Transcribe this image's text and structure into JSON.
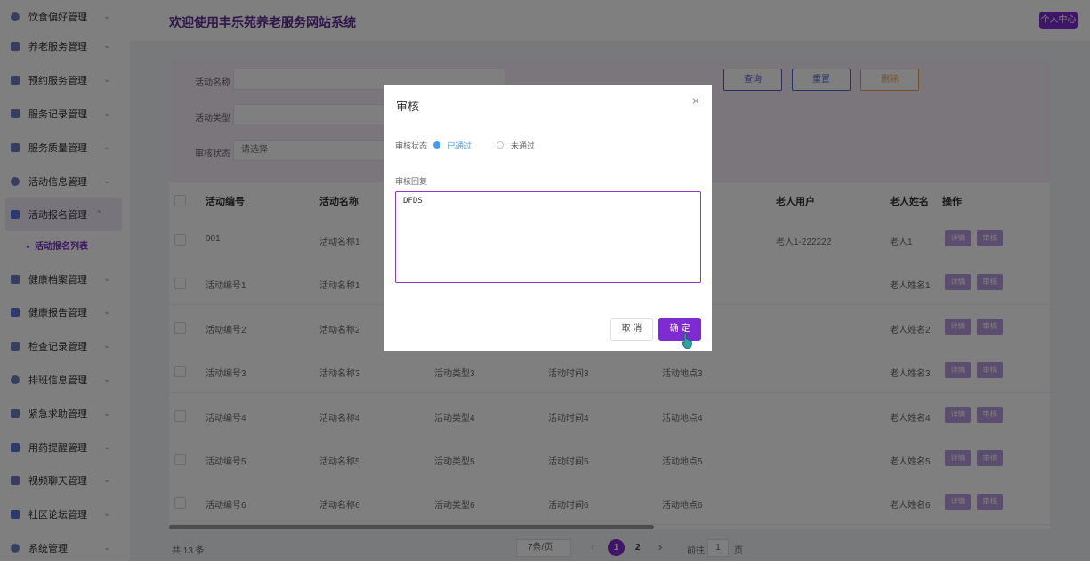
{
  "sidebar": {
    "items": [
      {
        "label": "饮食偏好管理",
        "icon": "drop-icon"
      },
      {
        "label": "养老服务管理",
        "icon": "document-icon"
      },
      {
        "label": "预约服务管理",
        "icon": "calendar-icon"
      },
      {
        "label": "服务记录管理",
        "icon": "edit-icon"
      },
      {
        "label": "服务质量管理",
        "icon": "chart-icon"
      },
      {
        "label": "活动信息管理",
        "icon": "drop-icon"
      },
      {
        "label": "活动报名管理",
        "icon": "list-icon",
        "active": true
      },
      {
        "label": "健康档案管理",
        "icon": "document-icon"
      },
      {
        "label": "健康报告管理",
        "icon": "list-icon"
      },
      {
        "label": "检查记录管理",
        "icon": "calendar-icon"
      },
      {
        "label": "排班信息管理",
        "icon": "drop-icon"
      },
      {
        "label": "紧急求助管理",
        "icon": "edit-icon"
      },
      {
        "label": "用药提醒管理",
        "icon": "list-icon"
      },
      {
        "label": "视频聊天管理",
        "icon": "document-icon"
      },
      {
        "label": "社区论坛管理",
        "icon": "list-icon"
      },
      {
        "label": "系统管理",
        "icon": "drop-icon"
      }
    ],
    "sub_item": "活动报名列表"
  },
  "header": {
    "title": "欢迎使用丰乐苑养老服务网站系统",
    "user_button": "个人中心"
  },
  "search": {
    "name_label": "活动名称",
    "type_label": "活动类型",
    "status_label": "审核状态",
    "status_placeholder": "请选择",
    "query_button": "查询",
    "reset_button": "重置",
    "delete_button": "删除"
  },
  "table": {
    "headers": {
      "id": "活动编号",
      "name": "活动名称",
      "elder_user": "老人用户",
      "elder_name": "老人姓名",
      "ops": "操作"
    },
    "rows": [
      {
        "id": "001",
        "name": "活动名称1",
        "type": "",
        "time": "",
        "place": "",
        "user": "老人1-222222",
        "elder": "老人1"
      },
      {
        "id": "活动编号1",
        "name": "活动名称1",
        "type": "",
        "time": "",
        "place": "",
        "user": "",
        "elder": "老人姓名1"
      },
      {
        "id": "活动编号2",
        "name": "活动名称2",
        "type": "",
        "time": "",
        "place": "",
        "user": "",
        "elder": "老人姓名2"
      },
      {
        "id": "活动编号3",
        "name": "活动名称3",
        "type": "活动类型3",
        "time": "活动时间3",
        "place": "活动地点3",
        "user": "",
        "elder": "老人姓名3"
      },
      {
        "id": "活动编号4",
        "name": "活动名称4",
        "type": "活动类型4",
        "time": "活动时间4",
        "place": "活动地点4",
        "user": "",
        "elder": "老人姓名4"
      },
      {
        "id": "活动编号5",
        "name": "活动名称5",
        "type": "活动类型5",
        "time": "活动时间5",
        "place": "活动地点5",
        "user": "",
        "elder": "老人姓名5"
      },
      {
        "id": "活动编号6",
        "name": "活动名称6",
        "type": "活动类型6",
        "time": "活动时间6",
        "place": "活动地点6",
        "user": "",
        "elder": "老人姓名6"
      }
    ],
    "detail_label": "详情",
    "audit_label": "审核"
  },
  "pagination": {
    "total": "共 13 条",
    "page_size": "7条/页",
    "prev": "‹",
    "next": "›",
    "pages": [
      "1",
      "2"
    ],
    "current_page": "1",
    "goto_label": "前往",
    "goto_value": "1",
    "page_suffix": "页"
  },
  "dialog": {
    "title": "审核",
    "close": "×",
    "status_label": "审核状态",
    "option_pass": "已通过",
    "option_fail": "未通过",
    "selected": "已通过",
    "reply_label": "审核回复",
    "reply_value": "DFDS",
    "cancel_button": "取 消",
    "confirm_button": "确 定"
  },
  "colors": {
    "brand": "#7e2bd2",
    "title": "#5e2a93",
    "op_button": "#b79bdb",
    "search_panel": "#f5ecf9",
    "radio_selected": "#409eff"
  }
}
